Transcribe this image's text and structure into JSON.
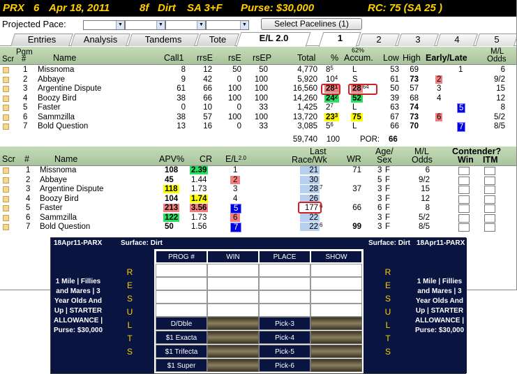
{
  "titlebar": {
    "track": "PRX",
    "race": "6",
    "date": "Apr 18, 2011",
    "distance": "8f",
    "surface": "Dirt",
    "class": "SA 3+F",
    "purse": "Purse: $30,000",
    "rc": "RC: 75  (SA 25 )"
  },
  "pace": {
    "label": "Projected Pace:",
    "select_label": "Select Pacelines  (1)"
  },
  "tabs": [
    "Entries",
    "Analysis",
    "Tandems",
    "Tote",
    "E/L 2.0"
  ],
  "num_tabs": [
    "1",
    "2",
    "3",
    "4",
    "5"
  ],
  "top_table": {
    "headers": {
      "scr": "Scr",
      "pgm": "Pgm",
      "num": "#",
      "name": "Name",
      "call1": "Call1",
      "rrse": "rrsE",
      "rse": "rsE",
      "rsep": "rsEP",
      "total": "Total",
      "pct": "%",
      "accum_top": "62%",
      "accum": "Accum.",
      "low": "Low",
      "high": "High",
      "early_late": "Early/Late",
      "ml_top": "M/L",
      "ml": "Odds"
    },
    "rows": [
      {
        "pgm": "1",
        "name": "Missnoma",
        "call1": "8",
        "rrse": "12",
        "rse": "50",
        "rsep": "50",
        "total": "4,770",
        "pct": "8",
        "pct_sup": "5",
        "accum": "L",
        "low": "53",
        "high": "69",
        "early": "",
        "late": "1",
        "odds": "6"
      },
      {
        "pgm": "2",
        "name": "Abbaye",
        "call1": "9",
        "rrse": "42",
        "rse": "0",
        "rsep": "100",
        "total": "5,920",
        "pct": "10",
        "pct_sup": "4",
        "accum": "S",
        "low": "61",
        "high": "73",
        "early": "2",
        "late": "",
        "odds": "9/2"
      },
      {
        "pgm": "3",
        "name": "Argentine Dispute",
        "call1": "61",
        "rrse": "66",
        "rse": "100",
        "rsep": "100",
        "total": "16,560",
        "pct": "28",
        "pct_sup": "1",
        "accum": "28",
        "accum_sup": "64",
        "low": "50",
        "high": "57",
        "early": "3",
        "late": "",
        "odds": "15"
      },
      {
        "pgm": "4",
        "name": "Boozy Bird",
        "call1": "38",
        "rrse": "66",
        "rse": "100",
        "rsep": "100",
        "total": "14,260",
        "pct": "24",
        "pct_sup": "2",
        "accum": "52",
        "low": "39",
        "high": "68",
        "early": "4",
        "late": "",
        "odds": "12"
      },
      {
        "pgm": "5",
        "name": "Faster",
        "call1": "0",
        "rrse": "10",
        "rse": "0",
        "rsep": "33",
        "total": "1,425",
        "pct": "2",
        "pct_sup": "7",
        "accum": "L",
        "low": "63",
        "high": "74",
        "early": "",
        "late": "5",
        "odds": "8"
      },
      {
        "pgm": "6",
        "name": "Sammzilla",
        "call1": "38",
        "rrse": "57",
        "rse": "100",
        "rsep": "100",
        "total": "13,720",
        "pct": "23",
        "pct_sup": "3",
        "accum": "75",
        "low": "67",
        "high": "73",
        "early": "6",
        "late": "",
        "odds": "5/2"
      },
      {
        "pgm": "7",
        "name": "Bold Question",
        "call1": "13",
        "rrse": "16",
        "rse": "0",
        "rsep": "33",
        "total": "3,085",
        "pct": "5",
        "pct_sup": "6",
        "accum": "L",
        "low": "66",
        "high": "70",
        "early": "",
        "late": "7",
        "odds": "8/5"
      }
    ],
    "footer": {
      "total": "59,740",
      "pct": "100",
      "por_label": "POR:",
      "por": "66"
    }
  },
  "bottom_table": {
    "headers": {
      "scr": "Scr",
      "num": "#",
      "name": "Name",
      "apv": "APV%",
      "cr": "CR",
      "el": "E/L",
      "el_sup": "2.0",
      "last_top": "Last",
      "last": "Race/Wk",
      "wr": "WR",
      "agesex_top": "Age/",
      "agesex": "Sex",
      "ml_top": "M/L",
      "ml": "Odds",
      "contender": "Contender?",
      "win": "Win",
      "itm": "ITM"
    },
    "rows": [
      {
        "num": "1",
        "name": "Missnoma",
        "apv": "108",
        "cr": "2.39",
        "el": "1",
        "last": "21",
        "last_sup": "",
        "wr": "71",
        "age": "3",
        "sex": "F",
        "odds": "6"
      },
      {
        "num": "2",
        "name": "Abbaye",
        "apv": "45",
        "cr": "1.44",
        "el": "2",
        "last": "30",
        "last_sup": "",
        "wr": "",
        "age": "5",
        "sex": "F",
        "odds": "9/2"
      },
      {
        "num": "3",
        "name": "Argentine Dispute",
        "apv": "118",
        "cr": "1.73",
        "el": "3",
        "last": "28",
        "last_sup": "7",
        "wr": "37",
        "age": "3",
        "sex": "F",
        "odds": "15"
      },
      {
        "num": "4",
        "name": "Boozy Bird",
        "apv": "104",
        "cr": "1.74",
        "el": "4",
        "last": "26",
        "last_sup": "",
        "wr": "",
        "age": "3",
        "sex": "F",
        "odds": "12"
      },
      {
        "num": "5",
        "name": "Faster",
        "apv": "213",
        "cr": "3.56",
        "el": "5",
        "last": "177",
        "last_sup": "6",
        "wr": "66",
        "age": "6",
        "sex": "F",
        "odds": "8"
      },
      {
        "num": "6",
        "name": "Sammzilla",
        "apv": "122",
        "cr": "1.73",
        "el": "6",
        "last": "22",
        "last_sup": "",
        "wr": "",
        "age": "3",
        "sex": "F",
        "odds": "5/2"
      },
      {
        "num": "7",
        "name": "Bold Question",
        "apv": "50",
        "cr": "1.56",
        "el": "7",
        "last": "22",
        "last_sup": "6",
        "wr": "99",
        "age": "3",
        "sex": "F",
        "odds": "8/5"
      }
    ]
  },
  "board": {
    "left_id": "18Apr11-PARX",
    "left_surface": "Surface: Dirt",
    "right_surface": "Surface: Dirt",
    "right_id": "18Apr11-PARX",
    "side_text": "1 Mile | Fillies and Mares | 3 Year Olds And Up | STARTER ALLOWANCE | Purse: $30,000",
    "results_letters": [
      "R",
      "E",
      "S",
      "U",
      "L",
      "T",
      "S"
    ],
    "grid_headers": [
      "PROG #",
      "WIN",
      "PLACE",
      "SHOW"
    ],
    "wagers_left": [
      "D/Dble",
      "$1 Exacta",
      "$1 Trifecta",
      "$1 Super"
    ],
    "wagers_right": [
      "Pick-3",
      "Pick-4",
      "Pick-5",
      "Pick-6"
    ]
  },
  "colors": {
    "title_bg": "#000000",
    "title_fg": "#ffd000",
    "header_green": "#b0cca4",
    "highlight_yellow": "#ffff00",
    "highlight_green": "#28e060",
    "highlight_pink": "#f08080",
    "highlight_blue": "#0000e0",
    "board_navy": "#0a1440"
  }
}
